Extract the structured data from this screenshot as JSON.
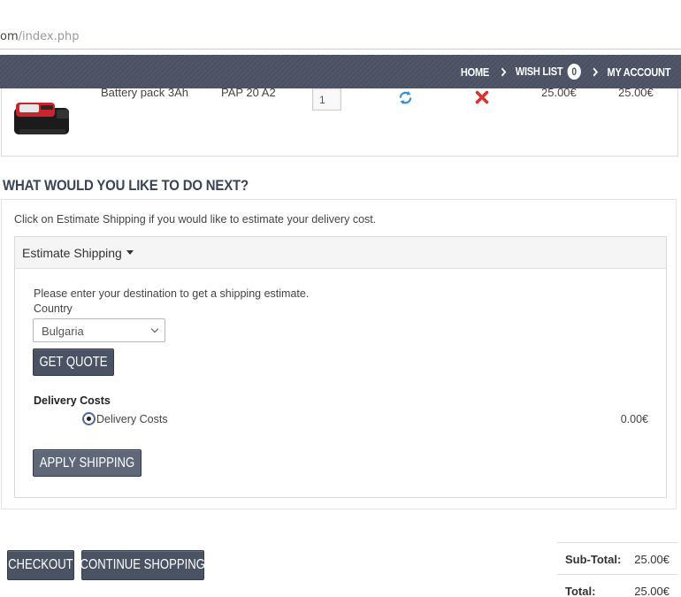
{
  "browser": {
    "url_host": "om",
    "url_path": "/index.php"
  },
  "nav": {
    "home": "HOME",
    "wish_list": "WISH LIST",
    "wish_count": "0",
    "my_account": "MY ACCOUNT"
  },
  "cart": {
    "item": {
      "name": "Battery pack 3Ah",
      "model": "PAP 20 A2",
      "quantity": "1",
      "unit_price": "25.00€",
      "total": "25.00€",
      "image_icon": "battery-pack-icon"
    }
  },
  "next": {
    "heading": "WHAT WOULD YOU LIKE TO DO NEXT?",
    "intro": "Click on Estimate Shipping if you would like to estimate your delivery cost.",
    "panel_title": "Estimate Shipping",
    "destination_text": "Please enter your destination to get a shipping estimate.",
    "country_label": "Country",
    "country_value": "Bulgaria",
    "get_quote_label": "GET QUOTE",
    "delivery_title": "Delivery Costs",
    "delivery_option_label": "Delivery Costs",
    "delivery_option_price": "0.00€",
    "apply_label": "APPLY SHIPPING"
  },
  "actions": {
    "checkout_label": "CHECKOUT",
    "continue_label": "CONTINUE SHOPPING"
  },
  "totals": [
    {
      "label": "Sub-Total:",
      "value": "25.00€"
    },
    {
      "label": "Total:",
      "value": "25.00€"
    }
  ],
  "colors": {
    "accent": "#4a5364",
    "remove": "#d9332b",
    "refresh": "#3b8fd6"
  }
}
